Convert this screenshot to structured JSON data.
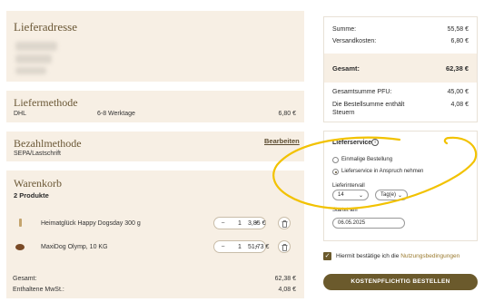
{
  "address": {
    "title": "Lieferadresse"
  },
  "shipping": {
    "title": "Liefermethode",
    "carrier": "DHL",
    "duration": "6-8 Werktage",
    "price": "6,80 €"
  },
  "payment": {
    "title": "Bezahlmethode",
    "edit_label": "Bearbeiten",
    "method": "SEPA/Lastschrift"
  },
  "cart": {
    "title": "Warenkorb",
    "count_label": "2 Produkte",
    "items": [
      {
        "name": "Heimatglück Happy Dogsday 300 g",
        "qty": "1",
        "price": "3,85 €"
      },
      {
        "name": "MaxiDog Olymp, 10 KG",
        "qty": "1",
        "price": "51,73 €"
      }
    ],
    "total_label": "Gesamt:",
    "total_value": "62,38 €",
    "vat_label": "Enthaltene MwSt.:",
    "vat_value": "4,08 €"
  },
  "summary": {
    "sum_label": "Summe:",
    "sum_value": "55,58 €",
    "shipping_label": "Versandkosten:",
    "shipping_value": "6,80 €",
    "total_label": "Gesamt:",
    "total_value": "62,38 €",
    "pfu_label": "Gesamtsumme PFU:",
    "pfu_value": "45,00 €",
    "tax_label_line1": "Die Bestellsumme enthält",
    "tax_label_line2": "Steuern",
    "tax_value": "4,08 €"
  },
  "delivery_service": {
    "title": "Lieferservice",
    "option_once": "Einmalige Bestellung",
    "option_service": "Lieferservice in Anspruch nehmen",
    "selected": "Lieferservice in Anspruch nehmen",
    "interval_label": "Lieferintervall",
    "interval_value": "14",
    "unit_value": "Tag(e)",
    "start_label": "Startet am",
    "start_value": "06.05.2025"
  },
  "terms": {
    "prefix": "Hiermit bestätige ich die",
    "link": "Nutzungsbedingungen",
    "checked": true
  },
  "order_button": {
    "label": "KOSTENPFLICHTIG BESTELLEN"
  },
  "colors": {
    "card_bg": "#f7efe4",
    "accent": "#6b5a2c",
    "highlight": "#f2c200"
  }
}
